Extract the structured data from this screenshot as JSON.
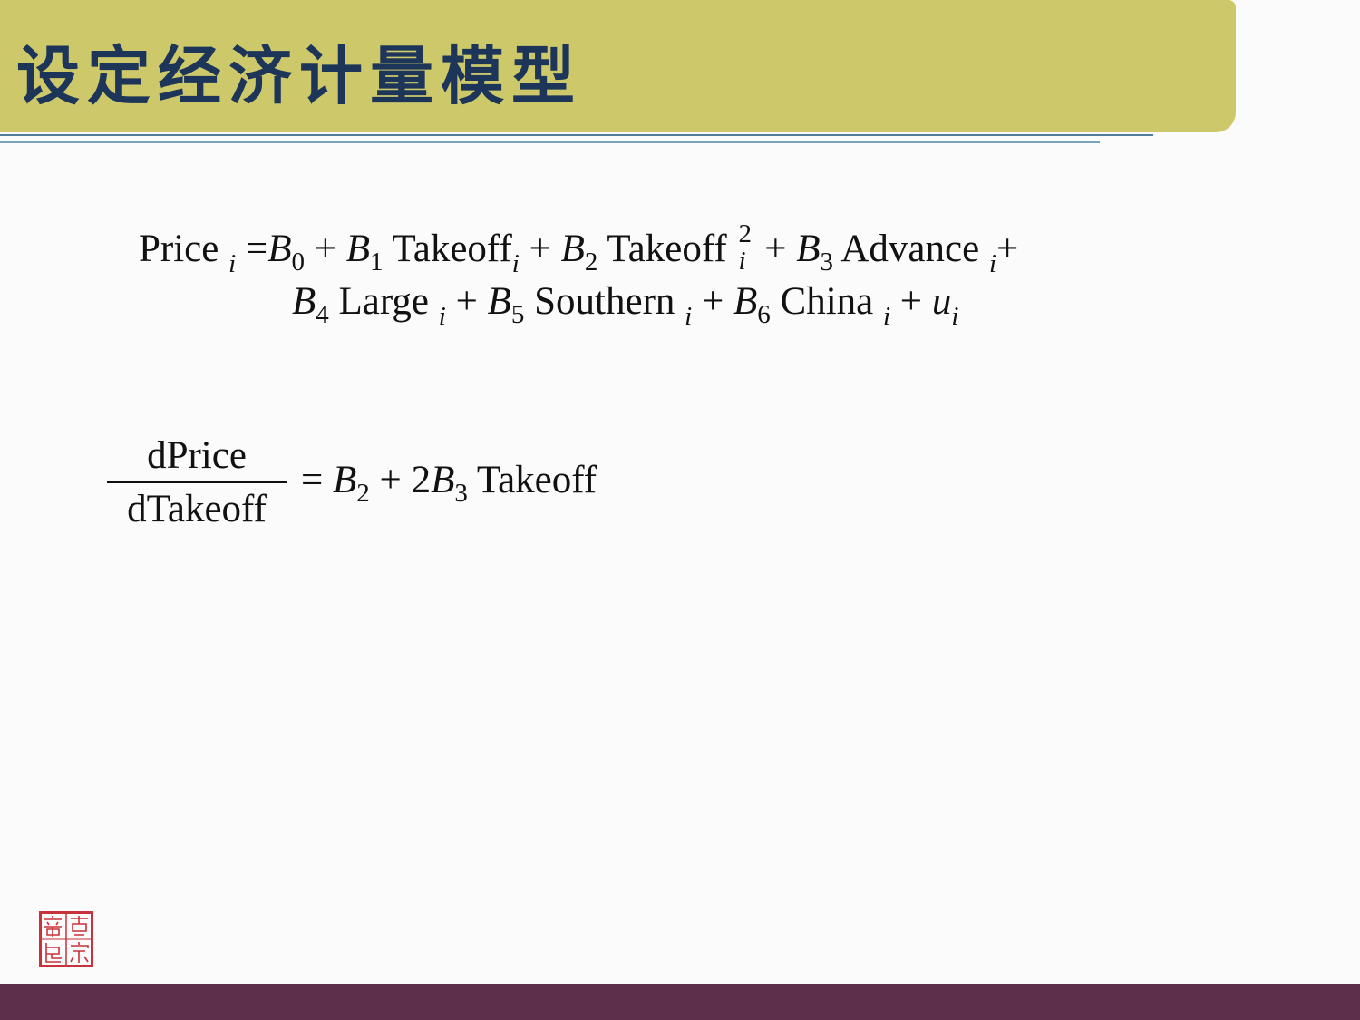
{
  "slide": {
    "title": "设定经济计量模型"
  },
  "equation_1": {
    "line1": {
      "price": "Price",
      "i": "i",
      "eq": "=",
      "B": "B",
      "sub0": "0",
      "sub1": "1",
      "sub2": "2",
      "sub3": "3",
      "plus": "+",
      "takeoff": "Takeoff",
      "sq": "2",
      "advance": "Advance"
    },
    "line2": {
      "B": "B",
      "sub4": "4",
      "sub5": "5",
      "sub6": "6",
      "i": "i",
      "plus": "+",
      "large": "Large",
      "southern": "Southern",
      "china": "China",
      "u": "u"
    }
  },
  "equation_2": {
    "numerator": "dPrice",
    "denominator": "dTakeoff",
    "eq": "=",
    "B": "B",
    "sub2": "2",
    "sub3": "3",
    "plus": "+",
    "two": "2",
    "takeoff": "Takeoff"
  },
  "seal": {
    "text": "古宗章印",
    "color": "#c8323a"
  },
  "colors": {
    "header": "#cdc96a",
    "title": "#1d3558",
    "footer": "#5e2f4b",
    "rule": "#4f7f9a"
  }
}
